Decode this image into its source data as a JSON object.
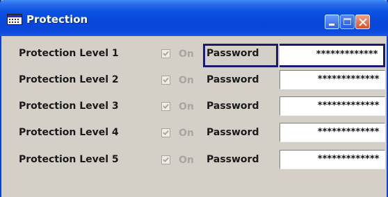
{
  "window": {
    "title": "Protection",
    "title_icon": "app-window-icon",
    "buttons": {
      "minimize": "minimize-icon",
      "maximize": "maximize-icon",
      "close": "close-icon"
    }
  },
  "colors": {
    "titlebar": "#0a54e3",
    "body": "#d4d0c8",
    "focus_border": "#1c1c6e"
  },
  "levels": [
    {
      "label": "Protection Level 1",
      "on_label": "On",
      "checked": true,
      "password_label": "Password",
      "password_value": "*************",
      "focused": true
    },
    {
      "label": "Protection Level 2",
      "on_label": "On",
      "checked": true,
      "password_label": "Password",
      "password_value": "*************",
      "focused": false
    },
    {
      "label": "Protection Level 3",
      "on_label": "On",
      "checked": true,
      "password_label": "Password",
      "password_value": "*************",
      "focused": false
    },
    {
      "label": "Protection Level 4",
      "on_label": "On",
      "checked": true,
      "password_label": "Password",
      "password_value": "*************",
      "focused": false
    },
    {
      "label": "Protection Level 5",
      "on_label": "On",
      "checked": true,
      "password_label": "Password",
      "password_value": "*************",
      "focused": false
    }
  ]
}
